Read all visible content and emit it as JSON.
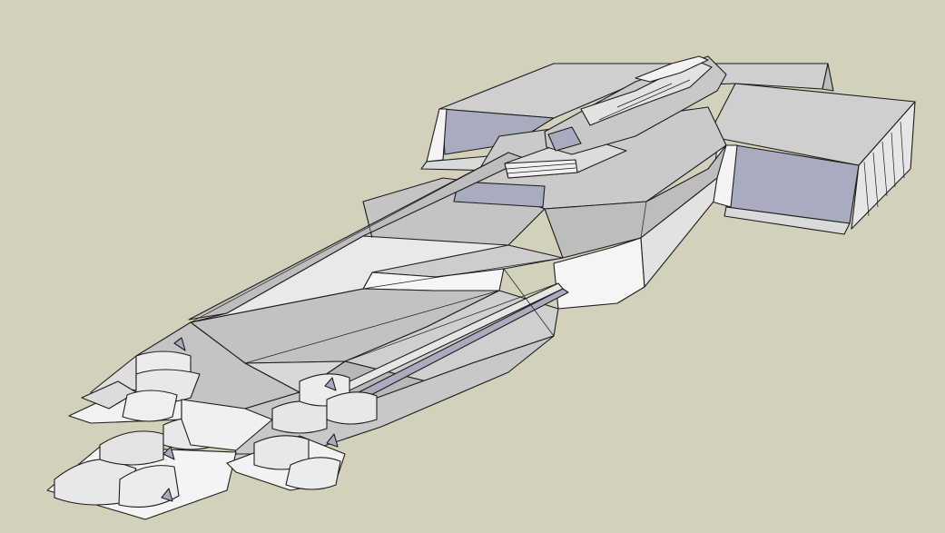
{
  "scene": {
    "subject": "starship-3d-model",
    "colors": {
      "background": "#d3d1bb",
      "face_top": "#c4c4c4",
      "face_light": "#e4e4e4",
      "face_white": "#f7f7f7",
      "face_mid": "#b3b3b3",
      "face_dark": "#9a9a9a",
      "face_blue": "#a9acbf",
      "edge": "#1c1c1c"
    }
  }
}
